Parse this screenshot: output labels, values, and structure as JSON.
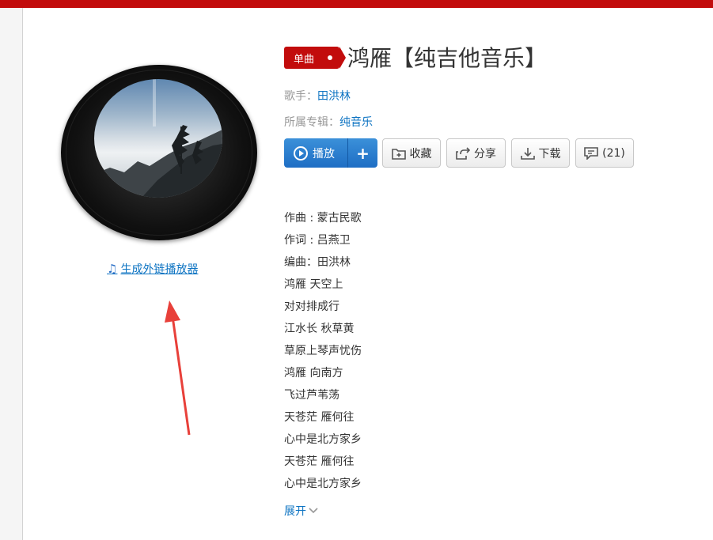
{
  "song": {
    "badge": "单曲",
    "title": "鸿雁【纯吉他音乐】",
    "singer_label": "歌手：",
    "singer": "田洪林",
    "album_label": "所属专辑：",
    "album": "纯音乐"
  },
  "actions": {
    "play": "播放",
    "add": "+",
    "collect": "收藏",
    "share": "分享",
    "download": "下载",
    "comment": "(21)"
  },
  "player_link": "生成外链播放器",
  "lyrics": [
    "作曲 : 蒙古民歌",
    "作词 : 吕燕卫",
    "编曲：田洪林",
    "鸿雁 天空上",
    "对对排成行",
    "江水长 秋草黄",
    "草原上琴声忧伤",
    "鸿雁 向南方",
    "飞过芦苇荡",
    "天苍茫 雁何往",
    "心中是北方家乡",
    "天苍茫 雁何往",
    "心中是北方家乡"
  ],
  "expand": "展开",
  "colors": {
    "brand_red": "#c20c0c",
    "link_blue": "#0c73c2",
    "play_blue": "#2a7fd0"
  }
}
